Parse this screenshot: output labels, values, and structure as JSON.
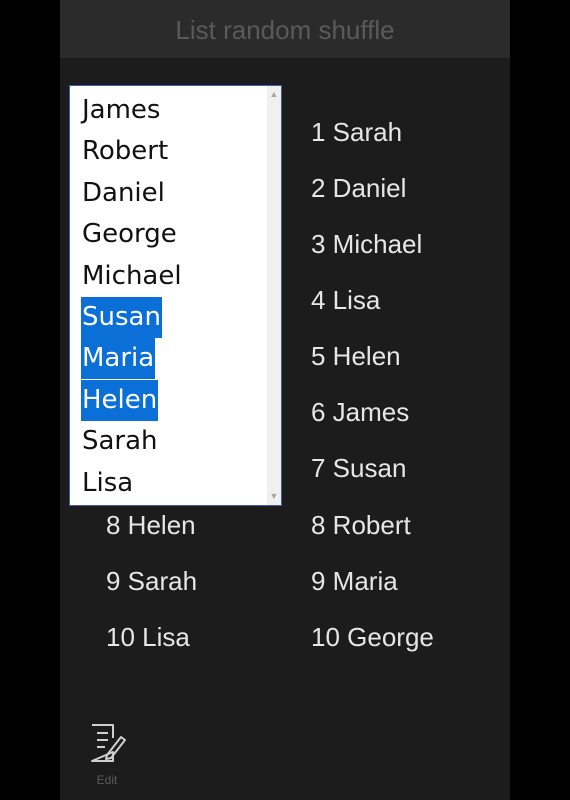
{
  "window": {
    "title": "List random shuffle"
  },
  "listbox": {
    "items": [
      "James",
      "Robert",
      "Daniel",
      "George",
      "Michael",
      "Susan",
      "Maria",
      "Helen",
      "Sarah",
      "Lisa"
    ],
    "selected": [
      "Susan",
      "Maria",
      "Helen"
    ]
  },
  "left_list": {
    "visible_items": [
      "8 Helen",
      "9 Sarah",
      "10 Lisa"
    ]
  },
  "right_list": {
    "items": [
      "1 Sarah",
      "2 Daniel",
      "3 Michael",
      "4 Lisa",
      "5 Helen",
      "6 James",
      "7 Susan",
      "8 Robert",
      "9 Maria",
      "10 George"
    ]
  },
  "appbar": {
    "edit_label": "Edit",
    "edit_icon": "edit-icon"
  },
  "colors": {
    "background": "#1c1c1c",
    "titlebar": "#2b2b2b",
    "selection": "#0a6fd6",
    "text": "#e6e6e6"
  }
}
